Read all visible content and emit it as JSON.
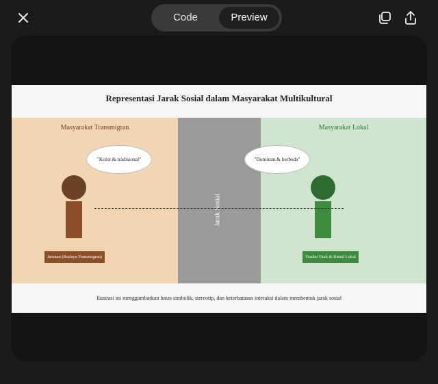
{
  "toolbar": {
    "close_icon": "close-icon",
    "tabs": [
      {
        "label": "Code",
        "selected": false
      },
      {
        "label": "Preview",
        "selected": true
      }
    ],
    "copy_icon": "copy-icon",
    "share_icon": "share-icon"
  },
  "preview": {
    "title": "Representasi Jarak Sosial dalam Masyarakat Multikultural",
    "left": {
      "label": "Masyarakat Transmigran",
      "bubble": "\"Kolot & tradisional\"",
      "tag": "Jaranan (Budaya Transmigran)"
    },
    "middle": {
      "label": "Jarak Sosial"
    },
    "right": {
      "label": "Masyarakat Lokal",
      "bubble": "\"Dominan & berbeda\"",
      "tag": "Tradisi Tuak & Ritual Lokal"
    },
    "caption": "Ilustrasi ini menggambarkan batas simbolik, stereotip, dan keterbatasan interaksi dalam membentuk jarak sosial"
  },
  "colors": {
    "left_bg": "#f2d6b4",
    "middle_bg": "#9a9a9a",
    "right_bg": "#d0e5cf",
    "left_figure": "#8b4f2a",
    "right_figure": "#3d8c3d"
  }
}
